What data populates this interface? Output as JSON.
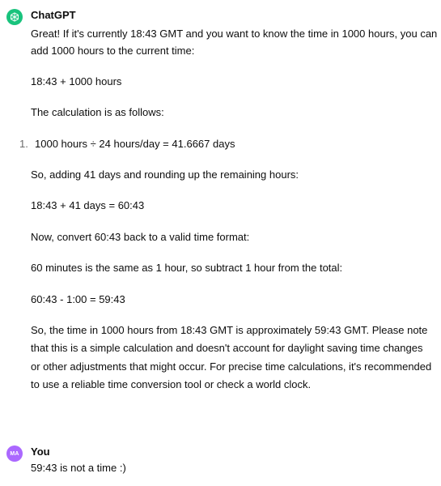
{
  "assistant": {
    "author": "ChatGPT",
    "lines": {
      "p1a": "Great! If it's currently 18:43 GMT and you want to know the time in 1000 hours, you can",
      "p1b": "add 1000 hours to the current time:",
      "p2": "18:43 + 1000 hours",
      "p3": "The calculation is as follows:",
      "list_num": "1.",
      "list_item": "1000 hours ÷ 24 hours/day = 41.6667 days",
      "p4": "So, adding 41 days and rounding up the remaining hours:",
      "p5": "18:43 + 41 days = 60:43",
      "p6": "Now, convert 60:43 back to a valid time format:",
      "p7": "60 minutes is the same as 1 hour, so subtract 1 hour from the total:",
      "p8": "60:43 - 1:00 = 59:43",
      "p9a": "So, the time in 1000 hours from 18:43 GMT is approximately 59:43 GMT. Please note",
      "p9b": "that this is a simple calculation and doesn't account for daylight saving time changes",
      "p9c": "or other adjustments that might occur. For precise time calculations, it's recommended",
      "p9d": "to use a reliable time conversion tool or check a world clock."
    },
    "avatar_icon": "openai-logo-icon"
  },
  "user": {
    "author": "You",
    "initials": "MA",
    "text": "59:43 is not a time :)"
  },
  "colors": {
    "gpt_avatar": "#19c37d",
    "user_avatar": "#ab68ff"
  }
}
